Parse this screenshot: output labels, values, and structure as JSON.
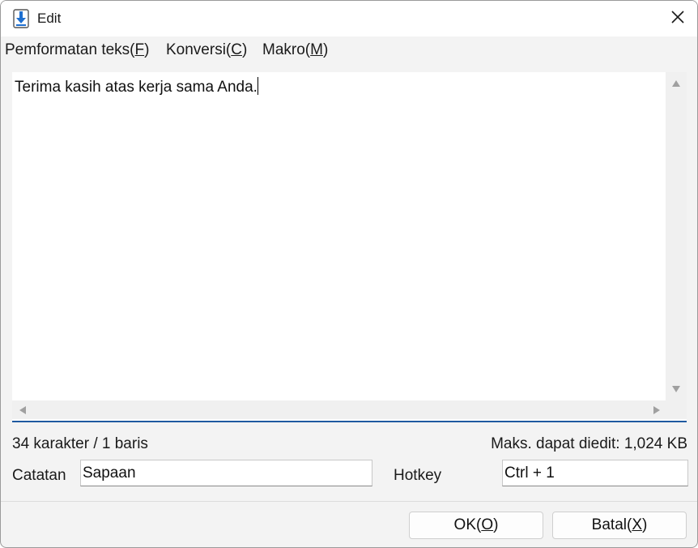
{
  "window": {
    "title": "Edit"
  },
  "icons": {
    "app": "download-arrow-icon",
    "close": "close-icon"
  },
  "menu": [
    {
      "label": "Pemformatan teks(",
      "key": "F",
      "suffix": ")"
    },
    {
      "label": "Konversi(",
      "key": "C",
      "suffix": ")"
    },
    {
      "label": "Makro(",
      "key": "M",
      "suffix": ")"
    }
  ],
  "editor": {
    "text": "Terima kasih atas kerja sama Anda."
  },
  "status": {
    "count": "34 karakter / 1 baris",
    "max": "Maks. dapat diedit: 1,024 KB"
  },
  "fields": {
    "note_label": "Catatan",
    "note_value": "Sapaan",
    "hotkey_label": "Hotkey",
    "hotkey_value": "Ctrl + 1"
  },
  "buttons": {
    "ok": {
      "label": "OK(",
      "key": "O",
      "suffix": ")"
    },
    "cancel": {
      "label": "Batal(",
      "key": "X",
      "suffix": ")"
    }
  },
  "colors": {
    "accent": "#1f5aa0",
    "icon_blue": "#1e6fd0"
  }
}
